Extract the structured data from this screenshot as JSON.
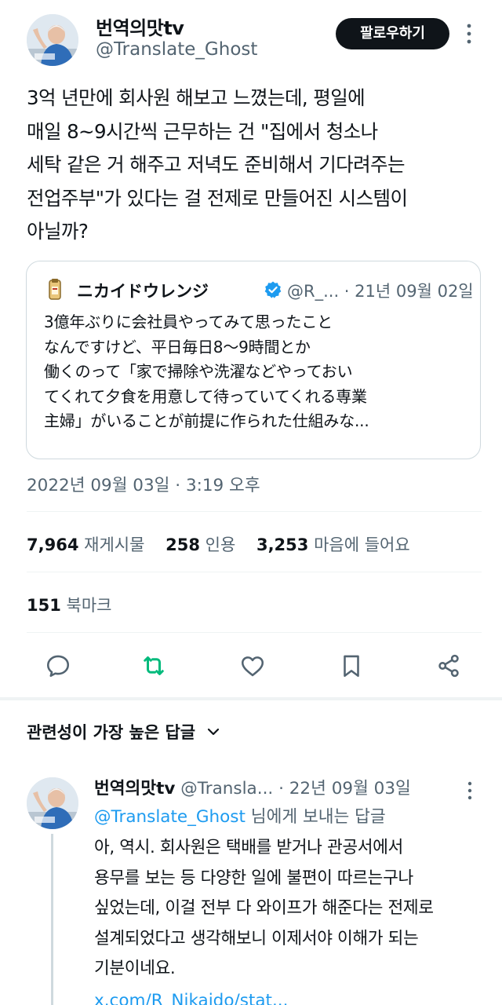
{
  "tweet": {
    "display_name": "번역의맛tv",
    "handle": "@Translate_Ghost",
    "follow_label": "팔로우하기",
    "more_icon": "more-vertical-icon",
    "text": "3억 년만에 회사원 해보고 느꼈는데, 평일에\n매일 8~9시간씩 근무하는 건 \"집에서 청소나\n세탁 같은 거 해주고 저녁도 준비해서 기다려주는\n전업주부\"가 있다는 걸 전제로 만들어진 시스템이\n아닐까?",
    "timestamp": "2022년 09월 03일 · 3:19 오후"
  },
  "quote": {
    "name": "ニカイドウレンジ",
    "meta": "@R_... · 21년 09월 02일",
    "verified_icon": "verified-badge-icon",
    "text": "3億年ぶりに会社員やってみて思ったこと\nなんですけど、平日毎日8〜9時間とか\n働くのって「家で掃除や洗濯などやっておい\nてくれて夕食を用意して待っていてくれる専業\n主婦」がいることが前提に作られた仕組みな..."
  },
  "stats": {
    "retweets_count": "7,964",
    "retweets_label": "재게시물",
    "quotes_count": "258",
    "quotes_label": "인용",
    "likes_count": "3,253",
    "likes_label": "마음에 들어요",
    "bookmarks_count": "151",
    "bookmarks_label": "북마크"
  },
  "actions": [
    "reply-icon",
    "retweet-icon",
    "like-icon",
    "bookmark-icon",
    "share-icon"
  ],
  "colors": {
    "text": "#0f1419",
    "secondary": "#536471",
    "accent": "#1d9bf0",
    "retweet": "#00ba7c",
    "border": "#cfd9de"
  },
  "replies": {
    "sort_label": "관련성이 가장 높은 답글",
    "items": [
      {
        "display_name": "번역의맛tv",
        "meta": "@Transla... · 22년 09월 03일",
        "reply_to_mention": "@Translate_Ghost",
        "reply_to_suffix": " 님에게 보내는 답글",
        "text": "아, 역시. 회사원은 택배를 받거나 관공서에서\n용무를 보는 등 다양한 일에 불편이 따르는구나\n싶었는데, 이걸 전부 다 와이프가 해준다는 전제로\n설계되었다고 생각해보니 이제서야 이해가 되는\n기분이네요.",
        "link": "x.com/R_Nikaido/stat..."
      }
    ]
  }
}
